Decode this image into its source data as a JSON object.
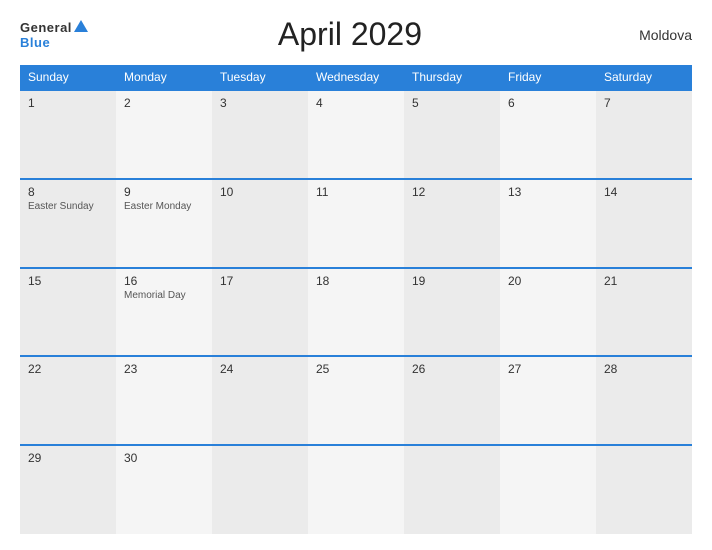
{
  "header": {
    "logo_general": "General",
    "logo_blue": "Blue",
    "title": "April 2029",
    "country": "Moldova"
  },
  "calendar": {
    "weekdays": [
      "Sunday",
      "Monday",
      "Tuesday",
      "Wednesday",
      "Thursday",
      "Friday",
      "Saturday"
    ],
    "weeks": [
      [
        {
          "day": "1",
          "event": ""
        },
        {
          "day": "2",
          "event": ""
        },
        {
          "day": "3",
          "event": ""
        },
        {
          "day": "4",
          "event": ""
        },
        {
          "day": "5",
          "event": ""
        },
        {
          "day": "6",
          "event": ""
        },
        {
          "day": "7",
          "event": ""
        }
      ],
      [
        {
          "day": "8",
          "event": "Easter Sunday"
        },
        {
          "day": "9",
          "event": "Easter Monday"
        },
        {
          "day": "10",
          "event": ""
        },
        {
          "day": "11",
          "event": ""
        },
        {
          "day": "12",
          "event": ""
        },
        {
          "day": "13",
          "event": ""
        },
        {
          "day": "14",
          "event": ""
        }
      ],
      [
        {
          "day": "15",
          "event": ""
        },
        {
          "day": "16",
          "event": "Memorial Day"
        },
        {
          "day": "17",
          "event": ""
        },
        {
          "day": "18",
          "event": ""
        },
        {
          "day": "19",
          "event": ""
        },
        {
          "day": "20",
          "event": ""
        },
        {
          "day": "21",
          "event": ""
        }
      ],
      [
        {
          "day": "22",
          "event": ""
        },
        {
          "day": "23",
          "event": ""
        },
        {
          "day": "24",
          "event": ""
        },
        {
          "day": "25",
          "event": ""
        },
        {
          "day": "26",
          "event": ""
        },
        {
          "day": "27",
          "event": ""
        },
        {
          "day": "28",
          "event": ""
        }
      ],
      [
        {
          "day": "29",
          "event": ""
        },
        {
          "day": "30",
          "event": ""
        },
        {
          "day": "",
          "event": ""
        },
        {
          "day": "",
          "event": ""
        },
        {
          "day": "",
          "event": ""
        },
        {
          "day": "",
          "event": ""
        },
        {
          "day": "",
          "event": ""
        }
      ]
    ]
  }
}
